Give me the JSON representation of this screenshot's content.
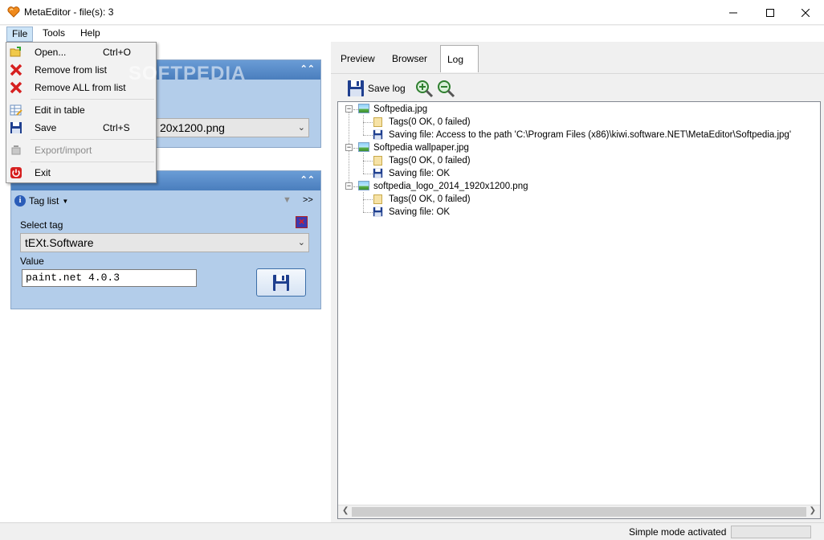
{
  "window": {
    "title": "MetaEditor - file(s): 3"
  },
  "menubar": {
    "file": "File",
    "tools": "Tools",
    "help": "Help"
  },
  "file_menu": {
    "open": {
      "label": "Open...",
      "shortcut": "Ctrl+O"
    },
    "remove": {
      "label": "Remove from list"
    },
    "remove_all": {
      "label": "Remove ALL from list"
    },
    "edit_table": {
      "label": "Edit in table"
    },
    "save": {
      "label": "Save",
      "shortcut": "Ctrl+S"
    },
    "export_import": {
      "label": "Export/import",
      "disabled": true
    },
    "exit": {
      "label": "Exit"
    }
  },
  "watermark": "SOFTPEDIA",
  "file_panel": {
    "selected_file_partial": "20x1200.png"
  },
  "tags_panel": {
    "tag_list_label": "Tag list",
    "more": ">>",
    "select_tag_label": "Select tag",
    "selected_tag": "tEXt.Software",
    "value_label": "Value",
    "value": "paint.net 4.0.3"
  },
  "tabs": {
    "preview": "Preview",
    "browser": "Browser",
    "log": "Log"
  },
  "log_toolbar": {
    "save_log": "Save log"
  },
  "log": [
    {
      "file": "Softpedia.jpg",
      "tags": "Tags(0 OK, 0 failed)",
      "saving": "Saving file: Access to the path 'C:\\Program Files (x86)\\kiwi.software.NET\\MetaEditor\\Softpedia.jpg'"
    },
    {
      "file": "Softpedia wallpaper.jpg",
      "tags": "Tags(0 OK, 0 failed)",
      "saving": "Saving file: OK"
    },
    {
      "file": "softpedia_logo_2014_1920x1200.png",
      "tags": "Tags(0 OK, 0 failed)",
      "saving": "Saving file: OK"
    }
  ],
  "statusbar": {
    "mode": "Simple mode activated"
  },
  "colors": {
    "panel_bg": "#b3cdea",
    "panel_header": "#4a7ebd",
    "accent_blue": "#2a5cb8"
  }
}
